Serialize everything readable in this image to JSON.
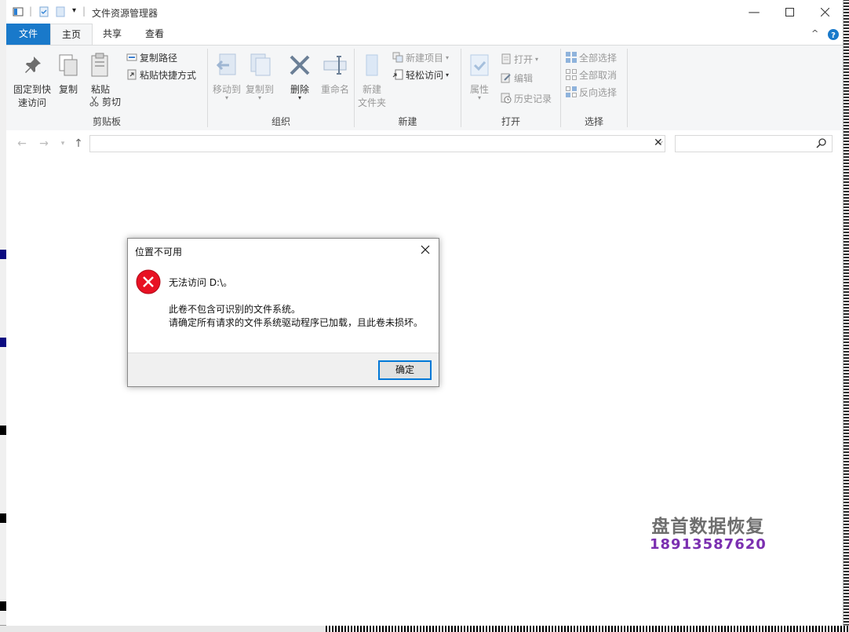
{
  "window": {
    "title": "文件资源管理器"
  },
  "tabs": {
    "file": "文件",
    "home": "主页",
    "share": "共享",
    "view": "查看"
  },
  "ribbon": {
    "clipboard": {
      "label": "剪贴板",
      "pin_line1": "固定到快",
      "pin_line2": "速访问",
      "copy": "复制",
      "paste": "粘贴",
      "copy_path": "复制路径",
      "paste_shortcut": "粘贴快捷方式",
      "cut": "剪切"
    },
    "organize": {
      "label": "组织",
      "move_to": "移动到",
      "copy_to": "复制到",
      "delete": "删除",
      "rename": "重命名"
    },
    "new": {
      "label": "新建",
      "new_folder_line1": "新建",
      "new_folder_line2": "文件夹",
      "new_item": "新建项目",
      "easy_access": "轻松访问"
    },
    "open": {
      "label": "打开",
      "properties": "属性",
      "open": "打开",
      "edit": "编辑",
      "history": "历史记录"
    },
    "select": {
      "label": "选择",
      "select_all": "全部选择",
      "select_none": "全部取消",
      "invert": "反向选择"
    }
  },
  "address": {
    "value": ""
  },
  "search": {
    "placeholder": ""
  },
  "dialog": {
    "title": "位置不可用",
    "message": "无法访问 D:\\。",
    "detail1": "此卷不包含可识别的文件系统。",
    "detail2": "请确定所有请求的文件系统驱动程序已加载，且此卷未损坏。",
    "ok": "确定"
  },
  "watermark": {
    "line1": "盘首数据恢复",
    "line2": "18913587620"
  },
  "colors": {
    "accent": "#1979ca",
    "error": "#e81123",
    "watermark_purple": "#7b2fb0"
  }
}
